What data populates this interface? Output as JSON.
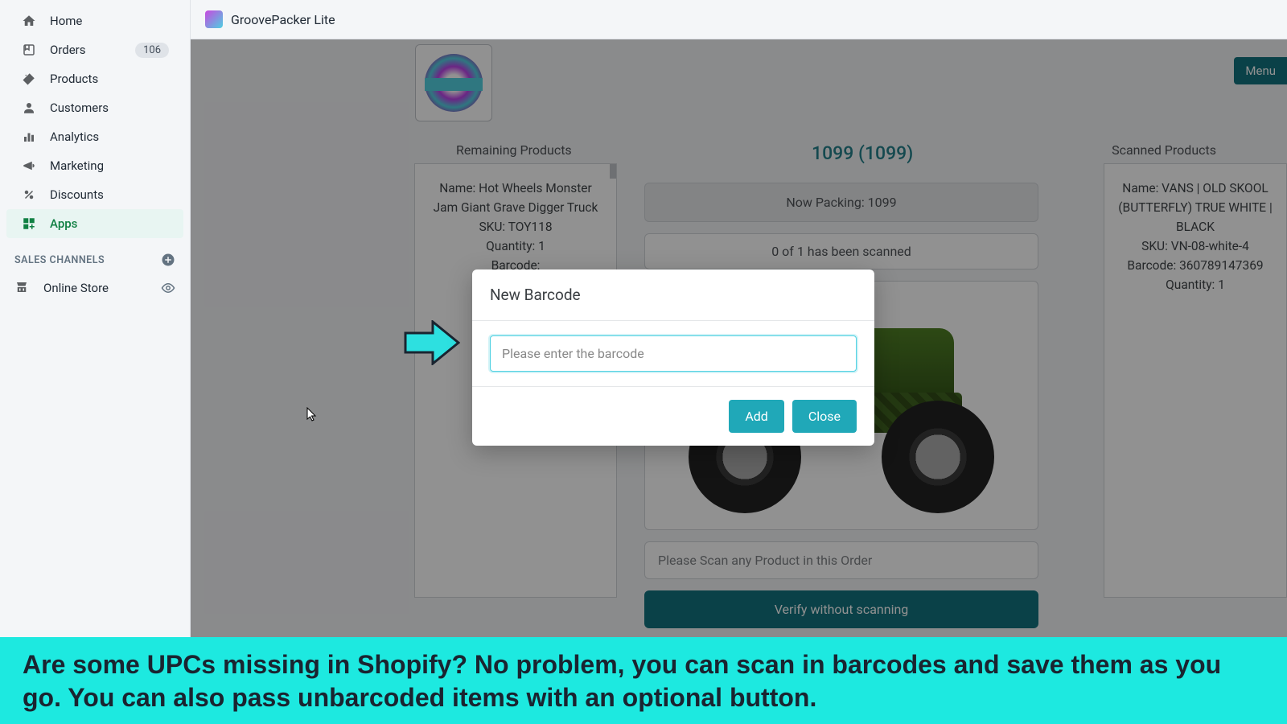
{
  "app": {
    "title": "GroovePacker Lite"
  },
  "sidebar": {
    "items": [
      {
        "label": "Home"
      },
      {
        "label": "Orders",
        "badge": "106"
      },
      {
        "label": "Products"
      },
      {
        "label": "Customers"
      },
      {
        "label": "Analytics"
      },
      {
        "label": "Marketing"
      },
      {
        "label": "Discounts"
      },
      {
        "label": "Apps"
      }
    ],
    "section_label": "SALES CHANNELS",
    "channels": [
      {
        "label": "Online Store"
      }
    ]
  },
  "topright": {
    "menu": "Menu"
  },
  "headers": {
    "remaining": "Remaining Products",
    "scanned": "Scanned Products",
    "order": "1099 (1099)"
  },
  "remaining_product": {
    "name_label": "Name: Hot Wheels Monster Jam Giant Grave Digger Truck",
    "sku": "SKU: TOY118",
    "qty": "Quantity: 1",
    "barcode": "Barcode:"
  },
  "scanned_product": {
    "name_label": "Name: VANS | OLD SKOOL (BUTTERFLY) TRUE WHITE | BLACK",
    "sku": "SKU: VN-08-white-4",
    "barcode": "Barcode: 360789147369",
    "qty": "Quantity: 1"
  },
  "center": {
    "now_packing": "Now Packing: 1099",
    "scan_status": "0 of 1 has been scanned",
    "scan_placeholder": "Please Scan any Product in this Order",
    "verify": "Verify without scanning"
  },
  "modal": {
    "title": "New Barcode",
    "placeholder": "Please enter the barcode",
    "add": "Add",
    "close": "Close"
  },
  "banner": {
    "text": "Are some UPCs missing in Shopify? No problem, you can scan in barcodes and save them as you go. You can also pass unbarcoded items with an optional button."
  }
}
